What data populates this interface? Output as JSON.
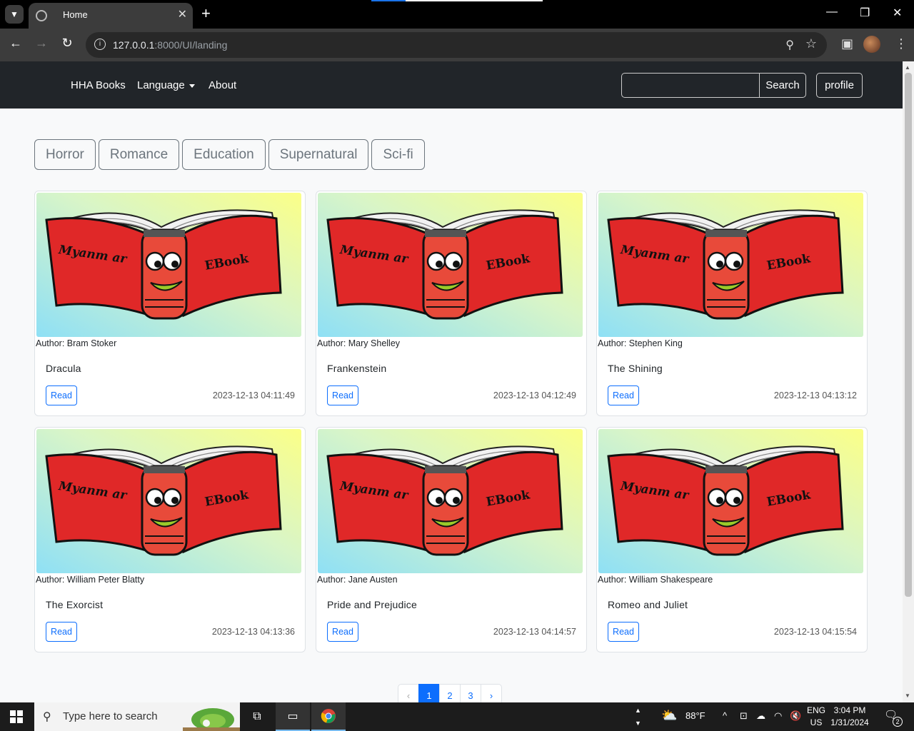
{
  "browser": {
    "tab_title": "Home",
    "url_host": "127.0.0.1",
    "url_rest": ":8000/UI/landing",
    "icons": [
      "tab-list-icon",
      "close-icon",
      "plus-icon",
      "back-icon",
      "forward-icon",
      "reload-icon",
      "info-icon",
      "zoom-icon",
      "star-icon",
      "side-panel-icon",
      "profile-avatar",
      "kebab-menu-icon"
    ]
  },
  "navbar": {
    "brand": "HHA Books",
    "language": "Language",
    "about": "About",
    "search_value": "",
    "search_button": "Search",
    "profile_button": "profile"
  },
  "genres": [
    "Horror",
    "Romance",
    "Education",
    "Supernatural",
    "Sci-fi"
  ],
  "cover": {
    "left_text": "Myanm ar",
    "right_text": "EBook"
  },
  "books": [
    {
      "author": "Author: Bram Stoker",
      "title": "Dracula",
      "read": "Read",
      "date": "2023-12-13 04:11:49"
    },
    {
      "author": "Author: Mary Shelley",
      "title": "Frankenstein",
      "read": "Read",
      "date": "2023-12-13 04:12:49"
    },
    {
      "author": "Author: Stephen King",
      "title": "The Shining",
      "read": "Read",
      "date": "2023-12-13 04:13:12"
    },
    {
      "author": "Author: William Peter Blatty",
      "title": "The Exorcist",
      "read": "Read",
      "date": "2023-12-13 04:13:36"
    },
    {
      "author": "Author: Jane Austen",
      "title": "Pride and Prejudice",
      "read": "Read",
      "date": "2023-12-13 04:14:57"
    },
    {
      "author": "Author: William Shakespeare",
      "title": "Romeo and Juliet",
      "read": "Read",
      "date": "2023-12-13 04:15:54"
    }
  ],
  "pagination": {
    "prev": "‹",
    "pages": [
      "1",
      "2",
      "3"
    ],
    "next": "›",
    "current": "1"
  },
  "taskbar": {
    "search_placeholder": "Type here to search",
    "weather": "88°F",
    "lang_top": "ENG",
    "lang_bottom": "US",
    "time": "3:04 PM",
    "date": "1/31/2024",
    "notifications": "2"
  },
  "colors": {
    "navbar_bg": "#212529",
    "accent": "#0d6efd",
    "genre_border": "#6c757d",
    "book_red": "#e53030"
  }
}
